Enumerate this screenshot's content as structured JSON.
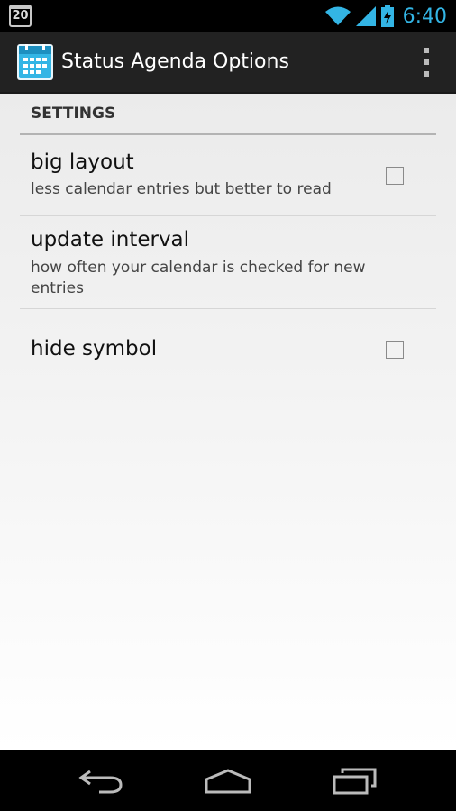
{
  "status_bar": {
    "notification_day": "20",
    "time": "6:40",
    "accent_color": "#33b5e5"
  },
  "action_bar": {
    "title": "Status Agenda Options",
    "icon": "calendar-app-icon"
  },
  "settings": {
    "section_header": "SETTINGS",
    "items": [
      {
        "title": "big layout",
        "summary": "less calendar entries but better to read",
        "checkbox": true,
        "checked": false
      },
      {
        "title": "update interval",
        "summary": "how often your calendar is checked for new entries",
        "checkbox": false
      },
      {
        "title": "hide symbol",
        "summary": "",
        "checkbox": true,
        "checked": false
      }
    ]
  },
  "nav_bar": {
    "icons": [
      "back-icon",
      "home-icon",
      "recents-icon"
    ]
  }
}
